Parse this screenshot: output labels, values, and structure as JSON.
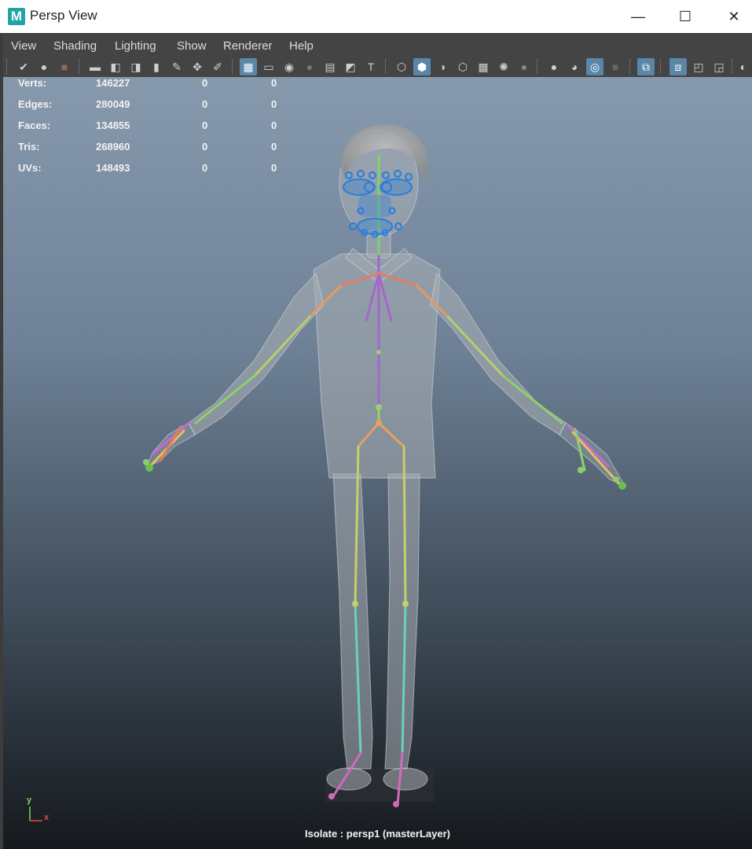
{
  "window": {
    "title": "Persp View",
    "app_icon_letter": "M",
    "minimize": "—",
    "maximize": "☐",
    "close": "✕"
  },
  "menu": [
    "View",
    "Shading",
    "Lighting",
    "Show",
    "Renderer",
    "Help"
  ],
  "toolbar_icons": [
    "select-camera-icon",
    "lock-camera-icon",
    "camera-attributes-icon",
    "bookmarks-icon",
    "image-plane-icon",
    "2d-pan-zoom-icon",
    "grease-pencil-icon",
    "grid-icon",
    "film-gate-icon",
    "resolution-gate-icon",
    "gate-mask-icon",
    "field-chart-icon",
    "safe-action-icon",
    "safe-title-icon",
    "wireframe-icon",
    "smooth-shade-icon",
    "default-material-icon",
    "wireframe-on-shaded-icon",
    "textured-icon",
    "use-all-lights-icon",
    "shadows-icon",
    "screen-space-ao-icon",
    "motion-blur-icon",
    "anti-aliasing-icon",
    "depth-of-field-icon",
    "isolate-select-icon",
    "xray-icon",
    "xray-active-components-icon",
    "xray-joints-icon",
    "backface-culling-icon"
  ],
  "stats": {
    "rows": [
      {
        "label": "Verts:",
        "value": "146227",
        "sel": "0",
        "tri": "0"
      },
      {
        "label": "Edges:",
        "value": "280049",
        "sel": "0",
        "tri": "0"
      },
      {
        "label": "Faces:",
        "value": "134855",
        "sel": "0",
        "tri": "0"
      },
      {
        "label": "Tris:",
        "value": "268960",
        "sel": "0",
        "tri": "0"
      },
      {
        "label": "UVs:",
        "value": "148493",
        "sel": "0",
        "tri": "0"
      }
    ]
  },
  "axis": {
    "y": "y",
    "x": "x"
  },
  "status": {
    "isolate": "Isolate : persp1 (masterLayer)"
  },
  "colors": {
    "viewport_top": "#8799ad",
    "viewport_bottom": "#15191d",
    "menu_bg": "#444444",
    "active_button": "#5a86a8",
    "face_controls": "#2f7fd8"
  }
}
